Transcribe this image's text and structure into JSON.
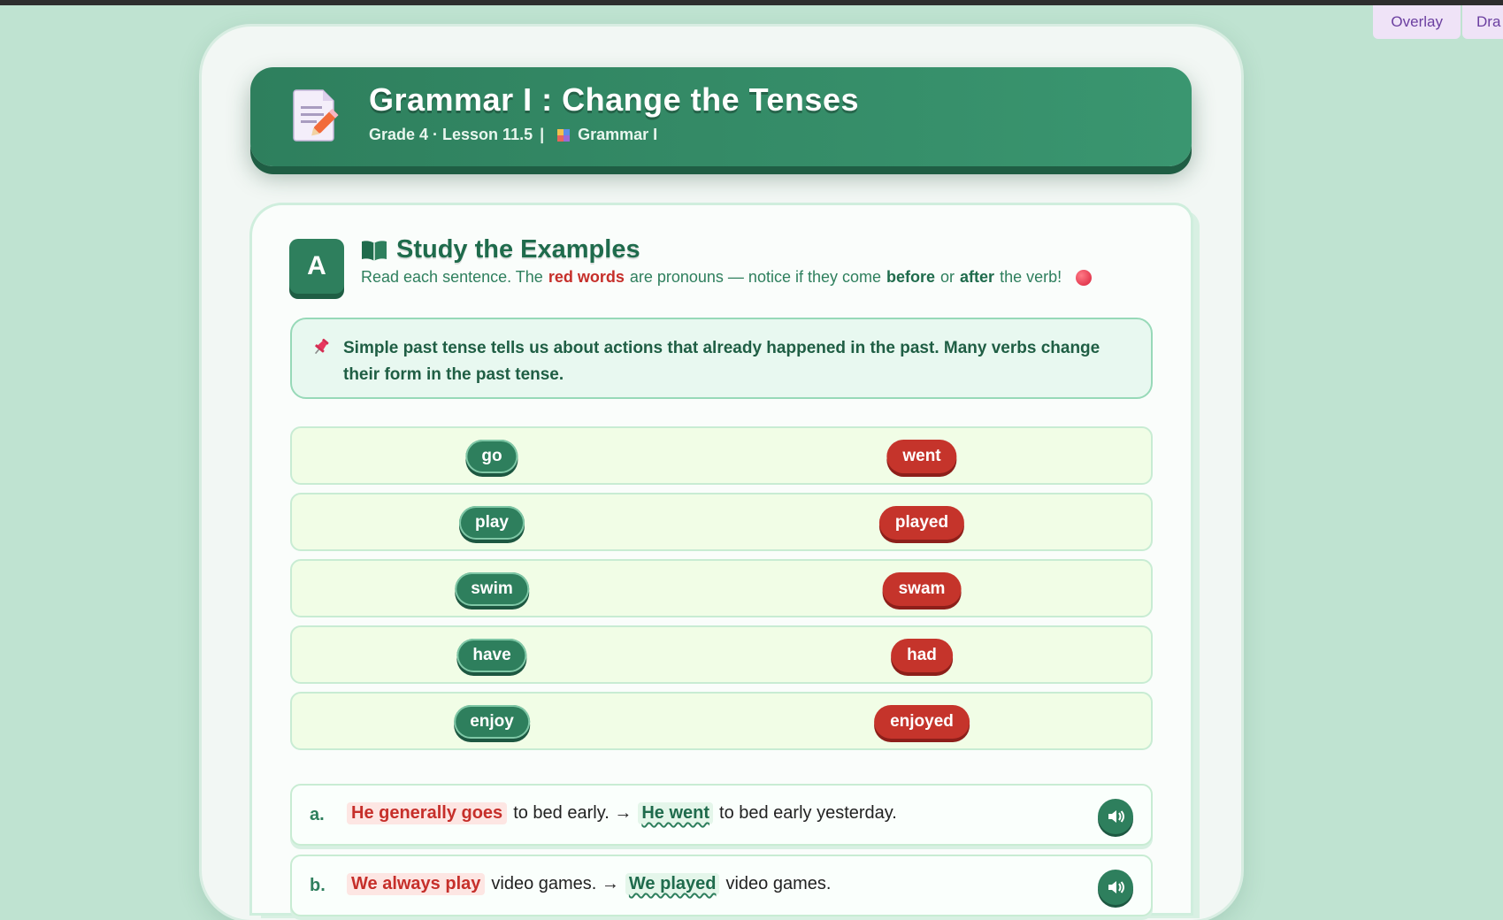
{
  "overlay_tabs": [
    "Overlay",
    "Dra"
  ],
  "header": {
    "title": "Grammar I : Change the Tenses",
    "meta": "Grade 4 · Lesson 11.5",
    "separator": "|",
    "category": "Grammar I",
    "icon": "document-pencil-icon"
  },
  "section": {
    "badge": "A",
    "title": "Study the Examples",
    "desc_1": "Read each sentence. The",
    "desc_red": "red words",
    "desc_2": "are pronouns — notice if they come",
    "desc_before": "before",
    "desc_or": "or",
    "desc_after": "after",
    "desc_3": "the verb!",
    "note": "Simple past tense tells us about actions that already happened in the past. Many verbs change their form in the past tense."
  },
  "verbs": [
    {
      "base": "go",
      "past": "went"
    },
    {
      "base": "play",
      "past": "played"
    },
    {
      "base": "swim",
      "past": "swam"
    },
    {
      "base": "have",
      "past": "had"
    },
    {
      "base": "enjoy",
      "past": "enjoyed"
    }
  ],
  "sentences": [
    {
      "letter": "a.",
      "red": "He generally goes",
      "mid": "to bed early. →",
      "green": "He went",
      "end": "to bed early yesterday."
    },
    {
      "letter": "b.",
      "red": "We always play",
      "mid": "video games. →",
      "green": "We played",
      "end": "video games."
    }
  ],
  "colors": {
    "primary_green": "#2e7f5d",
    "accent_red": "#c5342b",
    "background": "#bfe3d1"
  }
}
